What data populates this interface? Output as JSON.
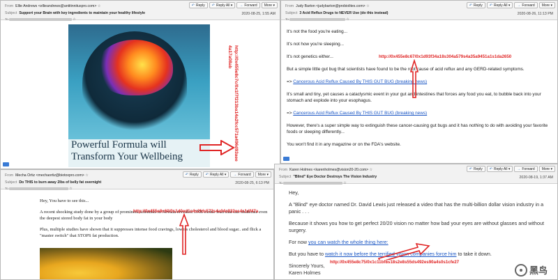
{
  "buttons": {
    "reply": "Reply",
    "reply_all": "Reply All",
    "forward": "Forward",
    "more": "More"
  },
  "tl": {
    "from_label": "From",
    "from": "Ellie Andrews <ellieandrews@antitinnituspro.com>",
    "subject_label": "Subject",
    "subject": "Support your Brain with key ingredients to maintain your healthy lifestyle",
    "date": "2020-08-25, 1:55 AM",
    "caption_line1": "Powerful Formula will",
    "caption_line2": "Transform Your Wellbeing",
    "url_part1": "http://0x455e8c7c/0x1f7f213ba14a2fcc571a496d93aee",
    "url_part2": "4a17a08ab"
  },
  "tr": {
    "from_label": "From",
    "from": "Judy Barton <judybarton@probiolites.com>",
    "subject_label": "Subject",
    "subject": "3 Acid Reflux Drugs to NEVER Use (do this instead)",
    "date": "2020-08-26, 11:13 PM",
    "p1": "It's not the food you're eating...",
    "p2": "It's not how you're sleeping...",
    "p3": "It's not genetics either...",
    "p4": "But a simple little gut bug that scientists have found to be the root cause of acid reflux and any GERD-related symptoms.",
    "p5_prefix": "=> ",
    "link1": "Cancerous Acid Reflux Caused By THIS GUT BUG (breaking news)",
    "p6": "It's small and tiny, yet causes a cataclysmic event in your gut and intestines that forces any food you eat, to bubble back into your stomach and explode into your esophagus.",
    "p7_prefix": "=> ",
    "link2": "Cancerous Acid Reflux Caused By THIS GUT BUG (breaking news)",
    "p8": "However, there's a super simple way to extinguish these cancer-causing gut bugs and it has nothing to do with avoiding your favorite foods or sleeping differently...",
    "p9": "You won't find it in any magazine or on the FDA's website.",
    "url": "http://0x455e8c67/0x1d93f34a18s304a579s4a35a9451a1s1da2650"
  },
  "bl": {
    "from_label": "From",
    "from": "Mecha Ortiz <mechaortiz@biotoxpro.com>",
    "subject_label": "Subject",
    "subject": "Do THIS to burn away 2lbs of belly fat overnight",
    "date": "2020-08-25, 6:13 PM",
    "p1": "Hey, You have to see this...",
    "p2": "A recent shocking study done by a group of prominent scientists in Nevada revealed ONE exotic fruit that can obliterate even the deepest stored body fat in your body",
    "p3": "Plus, multiple studies have shown that it suppresses intense food cravings, lowers cholesterol and blood sugar.. and flick a \"master switch\" that STOPS fat production.",
    "url": "http://0x455e8c60/0s1d0ed1s4s2fds572s4a04s932es4s1df47a"
  },
  "br": {
    "from_label": "From",
    "from": "Karen Holmes <karenholmes@vision20-20.com>",
    "subject_label": "Subject",
    "subject": "\"Blind\" Eye Doctor Destroys The Vision Industry",
    "date": "2020-08-19, 1:37 AM",
    "p1": "Hey,",
    "p2": "A \"Blind\" eye doctor named Dr. David Lewis just released a video that has the multi-billion dollar vision industry in a panic . . .",
    "p3": "Because it shows you how to get perfect 20/20 vision no matter how bad your eyes are without glasses and without surgery.",
    "p4_prefix": "For now ",
    "link1": "you can watch the whole thing here:",
    "p5_prefix": "But you have to ",
    "link2": "watch it now before the terrified vision companies force him",
    "p5_suffix": " to take it down.",
    "p6": "Sincerely Yours,",
    "p7": "Karen Holmes",
    "url": "http://0x455e8c75/0x1c11bf8s18s2e8s55ds492es90a4s0s1cfe27",
    "watermark": "黑鸟"
  },
  "colors": {
    "url_red": "#e02424",
    "link_blue": "#1a56c4"
  }
}
